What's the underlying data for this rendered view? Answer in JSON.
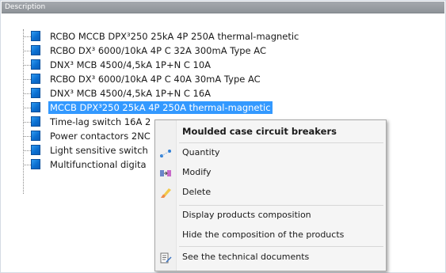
{
  "header": {
    "title": "Description"
  },
  "tree": {
    "items": [
      {
        "label": "RCBO MCCB DPX³250 25kA 4P 250A thermal-magnetic",
        "selected": false
      },
      {
        "label": "RCBO DX³ 6000/10kA 4P C 32A 300mA Type AC",
        "selected": false
      },
      {
        "label": "DNX³ MCB 4500/4,5kA 1P+N C 10A",
        "selected": false
      },
      {
        "label": "RCBO DX³ 6000/10kA 4P C 40A 30mA Type AC",
        "selected": false
      },
      {
        "label": "DNX³ MCB 4500/4,5kA 1P+N C 16A",
        "selected": false
      },
      {
        "label": "MCCB DPX³250 25kA 4P 250A thermal-magnetic",
        "selected": true
      },
      {
        "label": "Time-lag switch 16A 2",
        "selected": false
      },
      {
        "label": "Power contactors 2NC",
        "selected": false
      },
      {
        "label": "Light sensitive switch",
        "selected": false
      },
      {
        "label": "Multifunctional digita",
        "selected": false
      }
    ]
  },
  "context_menu": {
    "title": "Moulded case circuit breakers",
    "quantity": "Quantity",
    "modify": "Modify",
    "delete": "Delete",
    "display_composition": "Display products composition",
    "hide_composition": "Hide the composition of the products",
    "technical_documents": "See the technical documents"
  },
  "colors": {
    "selection": "#3399ff",
    "header_bg": "#999ea3",
    "product_icon": "#1180e0"
  }
}
